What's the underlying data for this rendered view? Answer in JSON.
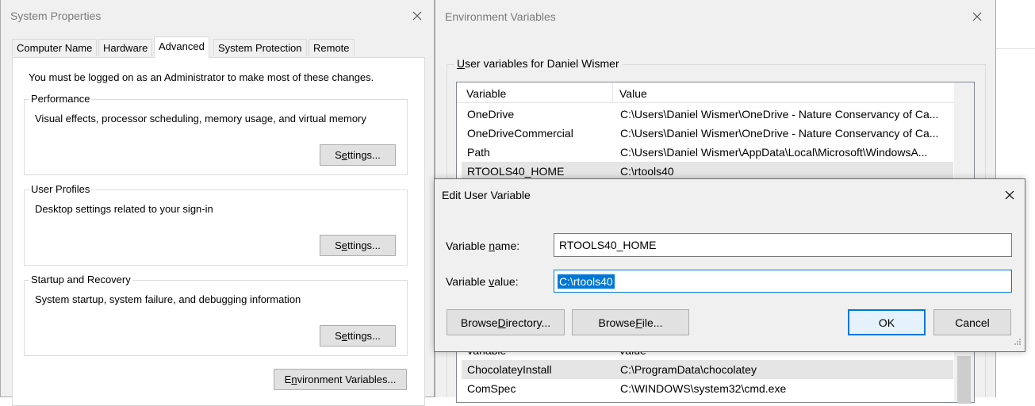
{
  "system_properties": {
    "title": "System Properties",
    "tabs": [
      {
        "label": "Computer Name"
      },
      {
        "label": "Hardware"
      },
      {
        "label": "Advanced"
      },
      {
        "label": "System Protection"
      },
      {
        "label": "Remote"
      }
    ],
    "admin_note": "You must be logged on as an Administrator to make most of these changes.",
    "groups": {
      "performance": {
        "title": "Performance",
        "desc": "Visual effects, processor scheduling, memory usage, and virtual memory"
      },
      "user_profiles": {
        "title": "User Profiles",
        "desc": "Desktop settings related to your sign-in"
      },
      "startup_recovery": {
        "title": "Startup and Recovery",
        "desc": "System startup, system failure, and debugging information"
      }
    },
    "settings_pre": "S",
    "settings_acc_perf": "e",
    "settings_post_perf": "ttings...",
    "settings_acc_prof": "e",
    "settings_post_prof": "ttings...",
    "settings_acc_start": "e",
    "settings_post_start": "ttings...",
    "env_button_pre": "E",
    "env_button_acc": "n",
    "env_button_post": "vironment Variables..."
  },
  "environment_variables": {
    "title": "Environment Variables",
    "user_group_pre": "U",
    "user_group_rest": "ser variables for Daniel Wismer",
    "columns": {
      "variable": "Variable",
      "value": "Value"
    },
    "user_rows": [
      {
        "variable": "OneDrive",
        "value": "C:\\Users\\Daniel Wismer\\OneDrive - Nature Conservancy of Ca..."
      },
      {
        "variable": "OneDriveCommercial",
        "value": "C:\\Users\\Daniel Wismer\\OneDrive - Nature Conservancy of Ca..."
      },
      {
        "variable": "Path",
        "value": "C:\\Users\\Daniel Wismer\\AppData\\Local\\Microsoft\\WindowsA..."
      },
      {
        "variable": "RTOOLS40_HOME",
        "value": "C:\\rtools40"
      }
    ],
    "system_rows": [
      {
        "variable": "ChocolateyInstall",
        "value": "C:\\ProgramData\\chocolatey"
      },
      {
        "variable": "ComSpec",
        "value": "C:\\WINDOWS\\system32\\cmd.exe"
      }
    ]
  },
  "edit_user_variable": {
    "title": "Edit User Variable",
    "name_label_pre": "Variable ",
    "name_label_acc": "n",
    "name_label_post": "ame:",
    "name_value": "RTOOLS40_HOME",
    "value_label_pre": "Variable ",
    "value_label_acc": "v",
    "value_label_post": "alue:",
    "value_value": "C:\\rtools40",
    "browse_dir_pre": "Browse ",
    "browse_dir_acc": "D",
    "browse_dir_post": "irectory...",
    "browse_file_pre": "Browse ",
    "browse_file_acc": "F",
    "browse_file_post": "ile...",
    "ok_label": "OK",
    "cancel_label": "Cancel"
  },
  "colors": {
    "accent": "#0078d7",
    "window_bg": "#f0f0f0",
    "title_text": "#7a7a7a"
  }
}
